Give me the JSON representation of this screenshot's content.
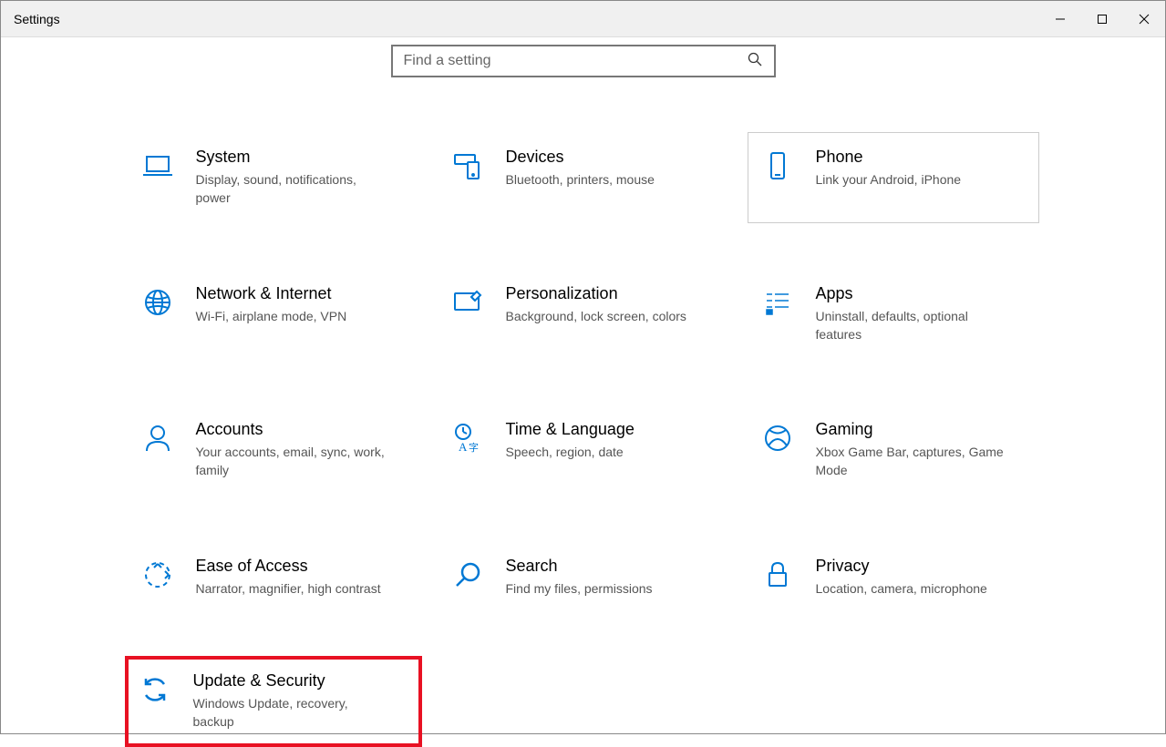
{
  "window": {
    "title": "Settings"
  },
  "search": {
    "placeholder": "Find a setting"
  },
  "cards": {
    "system": {
      "title": "System",
      "desc": "Display, sound, notifications, power"
    },
    "devices": {
      "title": "Devices",
      "desc": "Bluetooth, printers, mouse"
    },
    "phone": {
      "title": "Phone",
      "desc": "Link your Android, iPhone"
    },
    "network": {
      "title": "Network & Internet",
      "desc": "Wi-Fi, airplane mode, VPN"
    },
    "personalization": {
      "title": "Personalization",
      "desc": "Background, lock screen, colors"
    },
    "apps": {
      "title": "Apps",
      "desc": "Uninstall, defaults, optional features"
    },
    "accounts": {
      "title": "Accounts",
      "desc": "Your accounts, email, sync, work, family"
    },
    "time": {
      "title": "Time & Language",
      "desc": "Speech, region, date"
    },
    "gaming": {
      "title": "Gaming",
      "desc": "Xbox Game Bar, captures, Game Mode"
    },
    "ease": {
      "title": "Ease of Access",
      "desc": "Narrator, magnifier, high contrast"
    },
    "searchcat": {
      "title": "Search",
      "desc": "Find my files, permissions"
    },
    "privacy": {
      "title": "Privacy",
      "desc": "Location, camera, microphone"
    },
    "update": {
      "title": "Update & Security",
      "desc": "Windows Update, recovery, backup"
    }
  }
}
